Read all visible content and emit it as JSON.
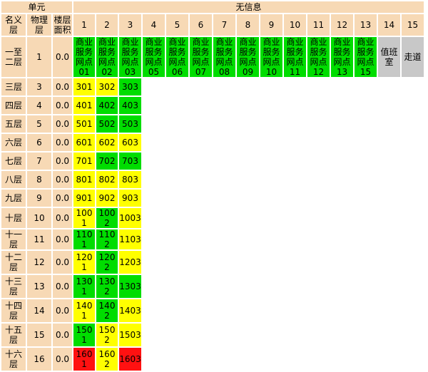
{
  "header": {
    "unit_label": "单元",
    "no_info_label": "无信息",
    "col_name": "名义层",
    "col_physical": "物理层",
    "col_area": "楼层面积",
    "unit_numbers": [
      "1",
      "2",
      "3",
      "4",
      "5",
      "6",
      "7",
      "8",
      "9",
      "10",
      "11",
      "12",
      "13",
      "14",
      "15"
    ]
  },
  "floors": [
    {
      "name": "一至二层",
      "physical": "1",
      "area": "0.0",
      "units": [
        {
          "label": "商业服务网点01",
          "status": "green"
        },
        {
          "label": "商业服务网点02",
          "status": "green"
        },
        {
          "label": "商业服务网点03",
          "status": "green"
        },
        {
          "label": "商业服务网点05",
          "status": "green"
        },
        {
          "label": "商业服务网点06",
          "status": "green"
        },
        {
          "label": "商业服务网点07",
          "status": "green"
        },
        {
          "label": "商业服务网点08",
          "status": "green"
        },
        {
          "label": "商业服务网点09",
          "status": "green"
        },
        {
          "label": "商业服务网点10",
          "status": "green"
        },
        {
          "label": "商业服务网点11",
          "status": "green"
        },
        {
          "label": "商业服务网点12",
          "status": "green"
        },
        {
          "label": "商业服务网点13",
          "status": "green"
        },
        {
          "label": "商业服务网点15",
          "status": "green"
        },
        {
          "label": "值班室",
          "status": "gray"
        },
        {
          "label": "走道",
          "status": "gray"
        }
      ]
    },
    {
      "name": "三层",
      "physical": "3",
      "area": "0.0",
      "units": [
        {
          "label": "301",
          "status": "yellow"
        },
        {
          "label": "302",
          "status": "yellow"
        },
        {
          "label": "303",
          "status": "green"
        }
      ]
    },
    {
      "name": "四层",
      "physical": "4",
      "area": "0.0",
      "units": [
        {
          "label": "401",
          "status": "yellow"
        },
        {
          "label": "402",
          "status": "green"
        },
        {
          "label": "403",
          "status": "green"
        }
      ]
    },
    {
      "name": "五层",
      "physical": "5",
      "area": "0.0",
      "units": [
        {
          "label": "501",
          "status": "yellow"
        },
        {
          "label": "502",
          "status": "green"
        },
        {
          "label": "503",
          "status": "green"
        }
      ]
    },
    {
      "name": "六层",
      "physical": "6",
      "area": "0.0",
      "units": [
        {
          "label": "601",
          "status": "yellow"
        },
        {
          "label": "602",
          "status": "yellow"
        },
        {
          "label": "603",
          "status": "yellow"
        }
      ]
    },
    {
      "name": "七层",
      "physical": "7",
      "area": "0.0",
      "units": [
        {
          "label": "701",
          "status": "yellow"
        },
        {
          "label": "702",
          "status": "green"
        },
        {
          "label": "703",
          "status": "green"
        }
      ]
    },
    {
      "name": "八层",
      "physical": "8",
      "area": "0.0",
      "units": [
        {
          "label": "801",
          "status": "yellow"
        },
        {
          "label": "802",
          "status": "yellow"
        },
        {
          "label": "803",
          "status": "yellow"
        }
      ]
    },
    {
      "name": "九层",
      "physical": "9",
      "area": "0.0",
      "units": [
        {
          "label": "901",
          "status": "yellow"
        },
        {
          "label": "902",
          "status": "yellow"
        },
        {
          "label": "903",
          "status": "yellow"
        }
      ]
    },
    {
      "name": "十层",
      "physical": "10",
      "area": "0.0",
      "units": [
        {
          "label": "1001",
          "status": "yellow"
        },
        {
          "label": "1002",
          "status": "green"
        },
        {
          "label": "1003",
          "status": "yellow"
        }
      ]
    },
    {
      "name": "十一层",
      "physical": "11",
      "area": "0.0",
      "units": [
        {
          "label": "1101",
          "status": "green"
        },
        {
          "label": "1102",
          "status": "green"
        },
        {
          "label": "1103",
          "status": "yellow"
        }
      ]
    },
    {
      "name": "十二层",
      "physical": "12",
      "area": "0.0",
      "units": [
        {
          "label": "1201",
          "status": "yellow"
        },
        {
          "label": "1202",
          "status": "green"
        },
        {
          "label": "1203",
          "status": "yellow"
        }
      ]
    },
    {
      "name": "十三层",
      "physical": "13",
      "area": "0.0",
      "units": [
        {
          "label": "1301",
          "status": "green"
        },
        {
          "label": "1302",
          "status": "green"
        },
        {
          "label": "1303",
          "status": "green"
        }
      ]
    },
    {
      "name": "十四层",
      "physical": "14",
      "area": "0.0",
      "units": [
        {
          "label": "1401",
          "status": "yellow"
        },
        {
          "label": "1402",
          "status": "green"
        },
        {
          "label": "1403",
          "status": "yellow"
        }
      ]
    },
    {
      "name": "十五层",
      "physical": "15",
      "area": "0.0",
      "units": [
        {
          "label": "1501",
          "status": "green"
        },
        {
          "label": "1502",
          "status": "yellow"
        },
        {
          "label": "1503",
          "status": "yellow"
        }
      ]
    },
    {
      "name": "十六层",
      "physical": "16",
      "area": "0.0",
      "units": [
        {
          "label": "1601",
          "status": "red"
        },
        {
          "label": "1602",
          "status": "yellow"
        },
        {
          "label": "1603",
          "status": "red"
        }
      ]
    }
  ],
  "colors": {
    "green": "#00dd00",
    "yellow": "#ffff00",
    "red": "#ff1111",
    "gray": "#c8c8c8",
    "header": "#f7d9b5"
  }
}
